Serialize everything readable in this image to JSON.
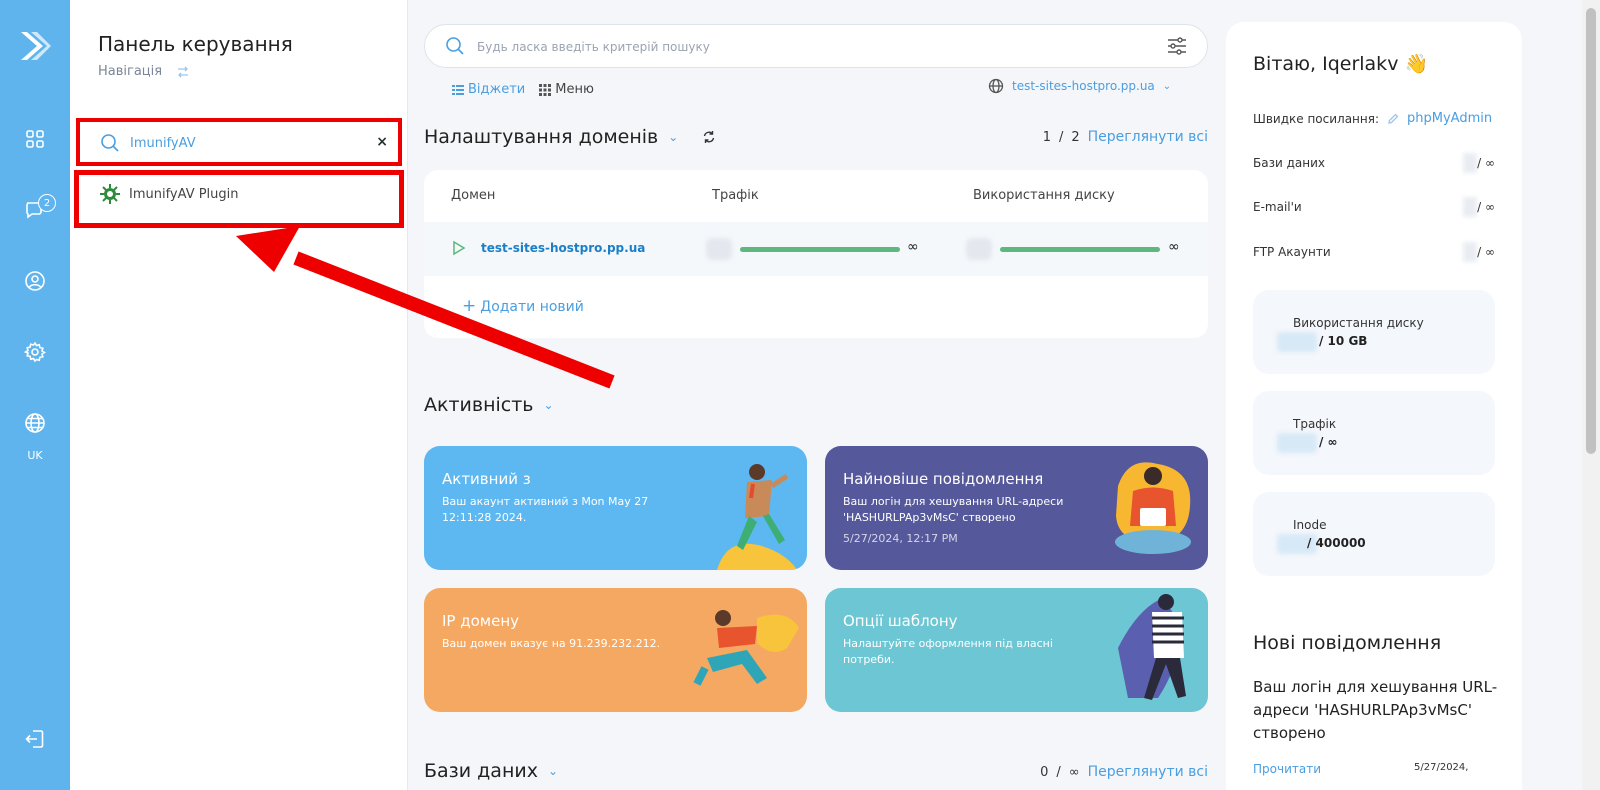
{
  "rail": {
    "lang": "UK",
    "badge_count": "2",
    "items": [
      {
        "icon": "dashboard-grid-icon"
      },
      {
        "icon": "support-chat-icon"
      },
      {
        "icon": "user-profile-icon"
      },
      {
        "icon": "gear-icon"
      },
      {
        "icon": "globe-icon"
      },
      {
        "icon": "logout-icon"
      }
    ]
  },
  "nav": {
    "title": "Панель керування",
    "subtitle": "Навігація",
    "search_value": "ImunifyAV",
    "clear_label": "×",
    "result_label": "ImunifyAV Plugin"
  },
  "main": {
    "search_placeholder": "Будь ласка введіть критерій пошуку",
    "tab_widgets": "Віджети",
    "tab_menu": "Меню",
    "domain_selector": "test-sites-hostpro.pp.ua",
    "domains_title": "Налаштування доменів",
    "domains_page_current": "1",
    "domains_page_sep": "/",
    "domains_page_total": "2",
    "view_all": "Переглянути всі",
    "col_domain": "Домен",
    "col_traffic": "Трафік",
    "col_disk": "Використання диску",
    "row_domain": "test-sites-hostpro.pp.ua",
    "traffic_fill": 1.0,
    "disk_fill": 1.0,
    "infinity": "∞",
    "add_new": "Додати новий",
    "activity_title": "Активність",
    "cards": [
      {
        "title": "Активний з",
        "text": "Ваш акаунт активний з Mon May 27 12:11:28 2024.",
        "color": "#5db7f1"
      },
      {
        "title": "Найновіше повідомлення",
        "text": "Ваш логін для хешування URL-адреси 'HASHURLPAp3vMsC' створено",
        "date": "5/27/2024, 12:17 PM",
        "color": "#55589a"
      },
      {
        "title": "IP домену",
        "text": "Ваш домен вказує на 91.239.232.212.",
        "color": "#f5a862"
      },
      {
        "title": "Опції шаблону",
        "text": "Налаштуйте оформлення під власні потреби.",
        "color": "#6cc6d3"
      }
    ],
    "db_title": "Бази даних",
    "db_page_current": "0",
    "db_page_sep": "/",
    "db_page_total": "∞",
    "db_view_all": "Переглянути всі"
  },
  "right": {
    "greeting": "Вітаю, Iqerlakv 👋",
    "quick_links_label": "Швидке посилання:",
    "quick_link": "phpMyAdmin",
    "stats_rows": [
      {
        "label": "Бази даних",
        "value": "/ ∞"
      },
      {
        "label": "E-mail'и",
        "value": "/ ∞"
      },
      {
        "label": "FTP Акаунти",
        "value": "/ ∞"
      }
    ],
    "disk_label": "Використання диску",
    "disk_value": "/  10 GB",
    "traffic_label": "Трафік",
    "traffic_value": "/  ∞",
    "inode_label": "Inode",
    "inode_value": "/  400000",
    "news_title": "Нові повідомлення",
    "news_text": "Ваш логін для хешування URL-адреси 'HASHURLPAp3vMsC' створено",
    "news_read": "Прочитати",
    "news_date": "5/27/2024,"
  },
  "colors": {
    "rail": "#5fb4ee",
    "accent": "#4a9ee0",
    "highlight": "#ee0000",
    "progress": "#5cb87e"
  }
}
